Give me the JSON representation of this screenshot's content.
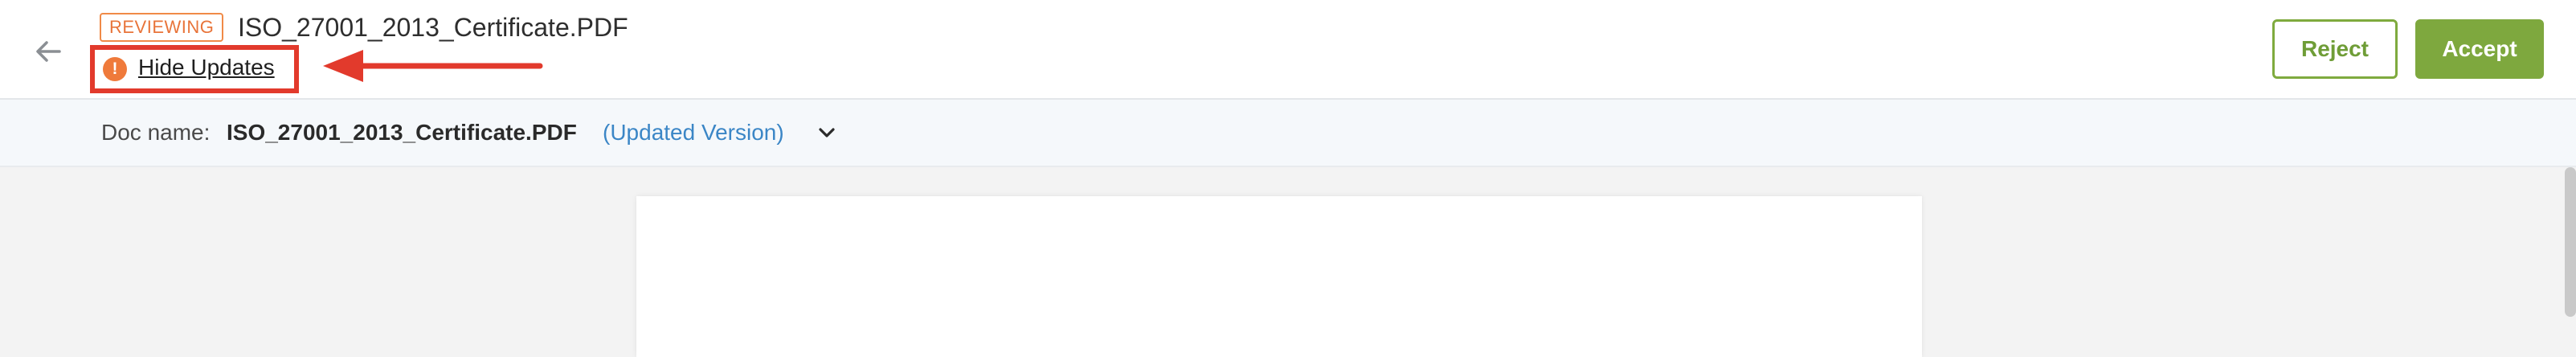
{
  "header": {
    "status_badge": "REVIEWING",
    "file_title": "ISO_27001_2013_Certificate.PDF",
    "hide_updates_label": "Hide Updates",
    "alert_icon_glyph": "!",
    "reject_label": "Reject",
    "accept_label": "Accept"
  },
  "doc_bar": {
    "label": "Doc name:",
    "name": "ISO_27001_2013_Certificate.PDF",
    "version": "(Updated Version)"
  },
  "icons": {
    "back": "arrow-left-icon",
    "alert": "alert-circle-icon",
    "annotation": "red-arrow-annotation",
    "dropdown": "chevron-down-icon"
  },
  "colors": {
    "accent_green": "#7ea83e",
    "badge_orange": "#e8743a",
    "annotation_red": "#e23a2c",
    "link_blue": "#3b86c6"
  }
}
